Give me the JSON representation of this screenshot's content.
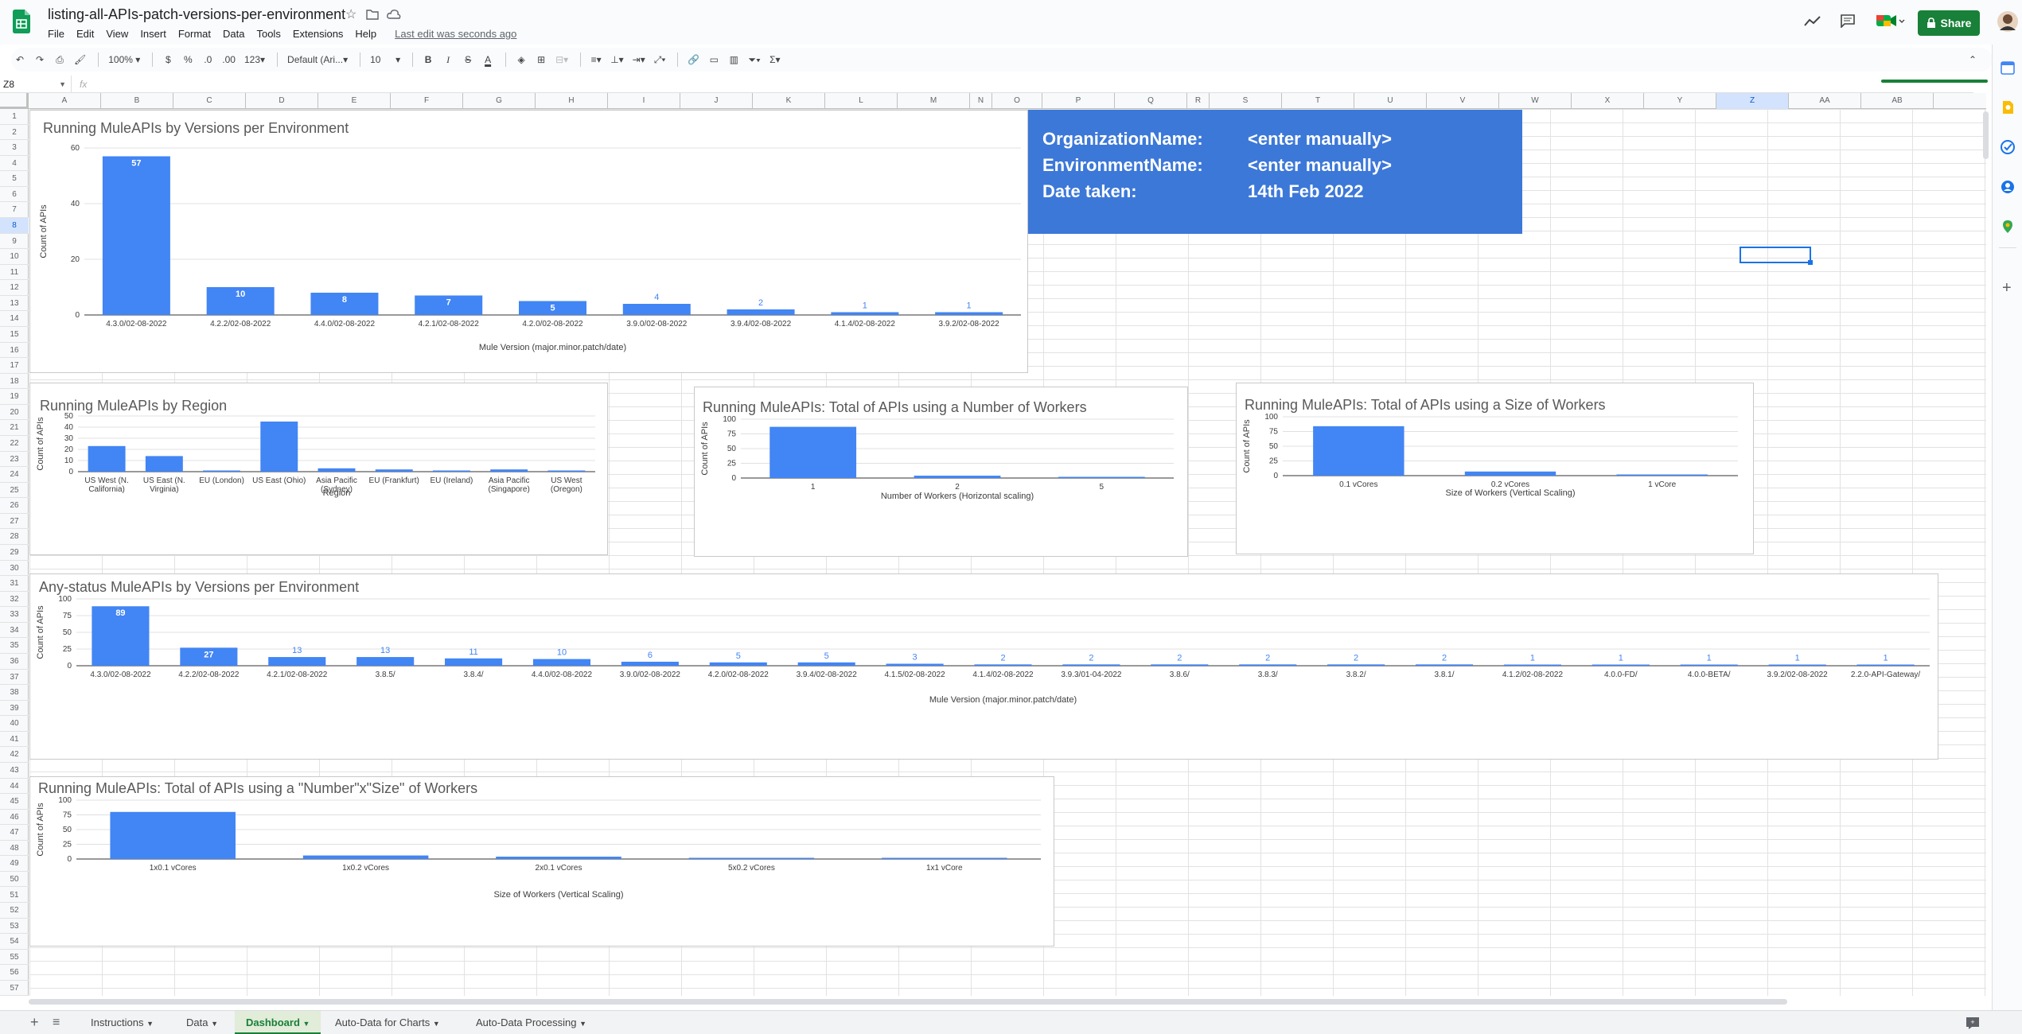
{
  "document": {
    "title": "listing-all-APIs-patch-versions-per-environment",
    "last_edit": "Last edit was seconds ago",
    "menu": [
      "File",
      "Edit",
      "View",
      "Insert",
      "Format",
      "Data",
      "Tools",
      "Extensions",
      "Help"
    ],
    "share_label": "Share"
  },
  "toolbar": {
    "zoom": "100%",
    "currency": "$",
    "percent": "%",
    "decrease_decimal": ".0",
    "increase_decimal": ".00",
    "more_formats": "123",
    "font": "Default (Ari...",
    "font_size": "10",
    "bold": "B",
    "italic": "I",
    "strike": "S",
    "text_color": "A",
    "function": "Σ"
  },
  "formula_bar": {
    "name_box": "Z8",
    "fx": "fx",
    "value": ""
  },
  "columns": [
    "A",
    "B",
    "C",
    "D",
    "E",
    "F",
    "G",
    "H",
    "I",
    "J",
    "K",
    "L",
    "M",
    "N",
    "O",
    "P",
    "Q",
    "R",
    "S",
    "T",
    "U",
    "V",
    "W",
    "X",
    "Y",
    "Z",
    "AA",
    "AB"
  ],
  "rows": [
    "1",
    "2",
    "3",
    "4",
    "5",
    "6",
    "7",
    "8",
    "9",
    "10",
    "11",
    "12",
    "13",
    "14",
    "15",
    "16",
    "17",
    "18",
    "19",
    "20",
    "21",
    "22",
    "23",
    "24",
    "25",
    "26",
    "27",
    "28",
    "29",
    "30",
    "31",
    "32",
    "33",
    "34",
    "35",
    "36",
    "37",
    "38",
    "39",
    "40",
    "41",
    "42",
    "43",
    "44",
    "45",
    "46",
    "47",
    "48",
    "49",
    "50",
    "51",
    "52",
    "53",
    "54",
    "55",
    "56",
    "57"
  ],
  "info_box": {
    "org_label": "OrganizationName:",
    "org_value": "<enter manually>",
    "env_label": "EnvironmentName:",
    "env_value": "<enter manually>",
    "date_label": "Date taken:",
    "date_value": "14th Feb 2022"
  },
  "sheet_tabs": [
    "Instructions",
    "Data",
    "Dashboard",
    "Auto-Data for Charts",
    "Auto-Data Processing"
  ],
  "active_tab": "Dashboard",
  "chart_data": [
    {
      "type": "bar",
      "title": "Running MuleAPIs by Versions per Environment",
      "xlabel": "Mule Version (major.minor.patch/date)",
      "ylabel": "Count of APIs",
      "categories": [
        "4.3.0/02-08-2022",
        "4.2.2/02-08-2022",
        "4.4.0/02-08-2022",
        "4.2.1/02-08-2022",
        "4.2.0/02-08-2022",
        "3.9.0/02-08-2022",
        "3.9.4/02-08-2022",
        "4.1.4/02-08-2022",
        "3.9.2/02-08-2022"
      ],
      "values": [
        57,
        10,
        8,
        7,
        5,
        4,
        2,
        1,
        1
      ],
      "yticks": [
        0,
        20,
        40,
        60
      ],
      "ylim": [
        0,
        60
      ],
      "data_labels": true,
      "grid": true
    },
    {
      "type": "bar",
      "title": "Running MuleAPIs by Region",
      "xlabel": "Region",
      "ylabel": "Count of APIs",
      "categories": [
        "US West (N. California)",
        "US East (N. Virginia)",
        "EU (London)",
        "US East (Ohio)",
        "Asia Pacific (Sydney)",
        "EU (Frankfurt)",
        "EU (Ireland)",
        "Asia Pacific (Singapore)",
        "US West (Oregon)"
      ],
      "values": [
        23,
        14,
        1,
        45,
        3,
        2,
        1,
        2,
        1
      ],
      "yticks": [
        0,
        10,
        20,
        30,
        40,
        50
      ],
      "ylim": [
        0,
        50
      ],
      "data_labels": false,
      "grid": true
    },
    {
      "type": "bar",
      "title": "Running MuleAPIs: Total of APIs using a Number of Workers",
      "xlabel": "Number of Workers (Horizontal scaling)",
      "ylabel": "Count of APIs",
      "categories": [
        "1",
        "2",
        "5"
      ],
      "values": [
        87,
        4,
        1
      ],
      "yticks": [
        0,
        25,
        50,
        75,
        100
      ],
      "ylim": [
        0,
        100
      ],
      "data_labels": false,
      "grid": true
    },
    {
      "type": "bar",
      "title": "Running MuleAPIs: Total of APIs using a Size of Workers",
      "xlabel": "Size of Workers (Vertical Scaling)",
      "ylabel": "Count of APIs",
      "categories": [
        "0.1 vCores",
        "0.2 vCores",
        "1 vCore"
      ],
      "values": [
        84,
        7,
        1
      ],
      "yticks": [
        0,
        25,
        50,
        75,
        100
      ],
      "ylim": [
        0,
        100
      ],
      "data_labels": false,
      "grid": true
    },
    {
      "type": "bar",
      "title": "Any-status MuleAPIs by Versions per Environment",
      "xlabel": "Mule Version (major.minor.patch/date)",
      "ylabel": "Count of APIs",
      "categories": [
        "4.3.0/02-08-2022",
        "4.2.2/02-08-2022",
        "4.2.1/02-08-2022",
        "3.8.5/",
        "3.8.4/",
        "4.4.0/02-08-2022",
        "3.9.0/02-08-2022",
        "4.2.0/02-08-2022",
        "3.9.4/02-08-2022",
        "4.1.5/02-08-2022",
        "4.1.4/02-08-2022",
        "3.9.3/01-04-2022",
        "3.8.6/",
        "3.8.3/",
        "3.8.2/",
        "3.8.1/",
        "4.1.2/02-08-2022",
        "4.0.0-FD/",
        "4.0.0-BETA/",
        "3.9.2/02-08-2022",
        "2.2.0-API-Gateway/"
      ],
      "values": [
        89,
        27,
        13,
        13,
        11,
        10,
        6,
        5,
        5,
        3,
        2,
        2,
        2,
        2,
        2,
        2,
        1,
        1,
        1,
        1,
        1
      ],
      "yticks": [
        0,
        25,
        50,
        75,
        100
      ],
      "ylim": [
        0,
        100
      ],
      "data_labels": true,
      "grid": true
    },
    {
      "type": "bar",
      "title": "Running MuleAPIs: Total of APIs using a \"Number\"x\"Size\" of Workers",
      "xlabel": "Size of Workers (Vertical Scaling)",
      "ylabel": "Count of APIs",
      "categories": [
        "1x0.1 vCores",
        "1x0.2 vCores",
        "2x0.1 vCores",
        "5x0.2 vCores",
        "1x1 vCore"
      ],
      "values": [
        80,
        6,
        4,
        1,
        1
      ],
      "yticks": [
        0,
        25,
        50,
        75,
        100
      ],
      "ylim": [
        0,
        100
      ],
      "data_labels": false,
      "grid": true
    }
  ]
}
